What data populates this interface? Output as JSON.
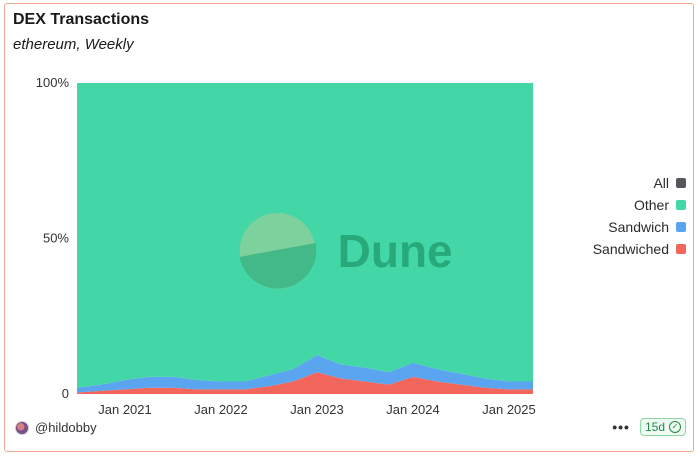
{
  "header": {
    "title": "DEX Transactions",
    "subtitle": "ethereum, Weekly"
  },
  "watermark": "Dune",
  "footer": {
    "author": "@hildobby",
    "age_badge": "15d",
    "more_icon": "ellipsis-icon"
  },
  "colors": {
    "other": "#43d6a7",
    "sandwich": "#5aa4f0",
    "sandwiched": "#f2665b",
    "all": "#54565c"
  },
  "chart_data": {
    "type": "area",
    "stacked_percent": true,
    "x_ticks": [
      "Jan 2021",
      "Jan 2022",
      "Jan 2023",
      "Jan 2024",
      "Jan 2025"
    ],
    "y_ticks": [
      "0",
      "50%",
      "100%"
    ],
    "ylim": [
      0,
      100
    ],
    "x": [
      "2020-07",
      "2020-10",
      "2021-01",
      "2021-04",
      "2021-07",
      "2021-10",
      "2022-01",
      "2022-04",
      "2022-07",
      "2022-10",
      "2023-01",
      "2023-04",
      "2023-07",
      "2023-10",
      "2024-01",
      "2024-04",
      "2024-07",
      "2024-10",
      "2025-01",
      "2025-04"
    ],
    "series": [
      {
        "name": "All",
        "values": [
          0,
          0,
          0,
          0,
          0,
          0,
          0,
          0,
          0,
          0,
          0,
          0,
          0,
          0,
          0,
          0,
          0,
          0,
          0,
          0
        ]
      },
      {
        "name": "Sandwiched",
        "values": [
          0.5,
          1.0,
          1.5,
          2.0,
          2.0,
          1.5,
          1.5,
          1.5,
          2.5,
          4.0,
          7.0,
          5.0,
          4.0,
          3.0,
          5.5,
          4.0,
          3.0,
          2.0,
          1.5,
          1.5
        ]
      },
      {
        "name": "Sandwich",
        "values": [
          1.5,
          2.0,
          3.0,
          3.5,
          3.5,
          3.0,
          2.5,
          2.5,
          3.5,
          4.0,
          5.5,
          4.5,
          4.5,
          4.0,
          4.5,
          4.0,
          3.5,
          3.0,
          2.5,
          2.5
        ]
      },
      {
        "name": "Other",
        "values": [
          98.0,
          97.0,
          95.5,
          94.5,
          94.5,
          95.5,
          96.0,
          96.0,
          94.0,
          92.0,
          87.5,
          90.5,
          91.5,
          93.0,
          90.0,
          92.0,
          93.5,
          95.0,
          96.0,
          96.0
        ]
      }
    ],
    "legend": [
      "All",
      "Other",
      "Sandwich",
      "Sandwiched"
    ],
    "legend_position": "right"
  }
}
